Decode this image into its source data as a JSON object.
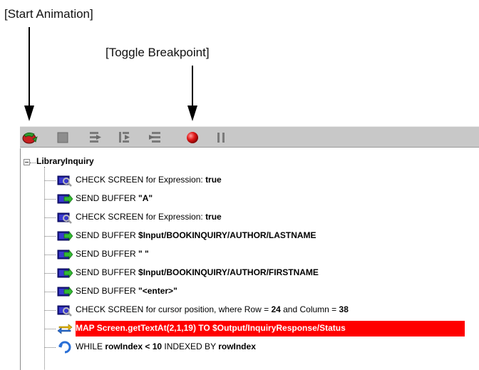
{
  "callouts": {
    "start_animation": "[Start Animation]",
    "toggle_breakpoint": "[Toggle Breakpoint]"
  },
  "toolbar": {
    "buttons": [
      {
        "name": "start-animation",
        "icon": "start-animation-icon"
      },
      {
        "name": "stop",
        "icon": "stop-icon"
      },
      {
        "name": "step-into",
        "icon": "step-into-icon"
      },
      {
        "name": "step-over",
        "icon": "step-over-icon"
      },
      {
        "name": "step-out",
        "icon": "step-out-icon"
      },
      {
        "name": "toggle-breakpoint",
        "icon": "breakpoint-icon"
      },
      {
        "name": "pause",
        "icon": "pause-icon"
      }
    ]
  },
  "tree": {
    "root_label": "LibraryInquiry",
    "rows": [
      {
        "icon": "check-screen-icon",
        "prefix": "CHECK SCREEN for Expression: ",
        "bold": "true",
        "suffix": "",
        "bold2": ""
      },
      {
        "icon": "send-buffer-icon",
        "prefix": "SEND BUFFER ",
        "bold": "\"A\"",
        "suffix": "",
        "bold2": ""
      },
      {
        "icon": "check-screen-icon",
        "prefix": "CHECK SCREEN for Expression: ",
        "bold": "true",
        "suffix": "",
        "bold2": ""
      },
      {
        "icon": "send-buffer-icon",
        "prefix": "SEND BUFFER ",
        "bold": "$Input/BOOKINQUIRY/AUTHOR/LASTNAME",
        "suffix": "",
        "bold2": ""
      },
      {
        "icon": "send-buffer-icon",
        "prefix": "SEND BUFFER ",
        "bold": "\" \"",
        "suffix": "",
        "bold2": ""
      },
      {
        "icon": "send-buffer-icon",
        "prefix": "SEND BUFFER ",
        "bold": "$Input/BOOKINQUIRY/AUTHOR/FIRSTNAME",
        "suffix": "",
        "bold2": ""
      },
      {
        "icon": "send-buffer-icon",
        "prefix": "SEND BUFFER ",
        "bold": "\"<enter>\"",
        "suffix": "",
        "bold2": ""
      },
      {
        "icon": "check-screen-icon",
        "prefix": "CHECK SCREEN for cursor position, where Row = ",
        "bold": "24",
        "suffix": " and Column = ",
        "bold2": "38"
      },
      {
        "icon": "map-icon",
        "prefix": "MAP Screen.getTextAt(2,1,19) TO $Output/InquiryResponse/Status",
        "bold": "",
        "suffix": "",
        "bold2": "",
        "highlighted": true
      },
      {
        "icon": "while-loop-icon",
        "prefix": "WHILE ",
        "bold": "rowIndex < 10",
        "suffix": " INDEXED BY ",
        "bold2": "rowIndex"
      }
    ]
  },
  "colors": {
    "highlight": "#ff0000",
    "toolbar_bg": "#c8c8c8"
  }
}
